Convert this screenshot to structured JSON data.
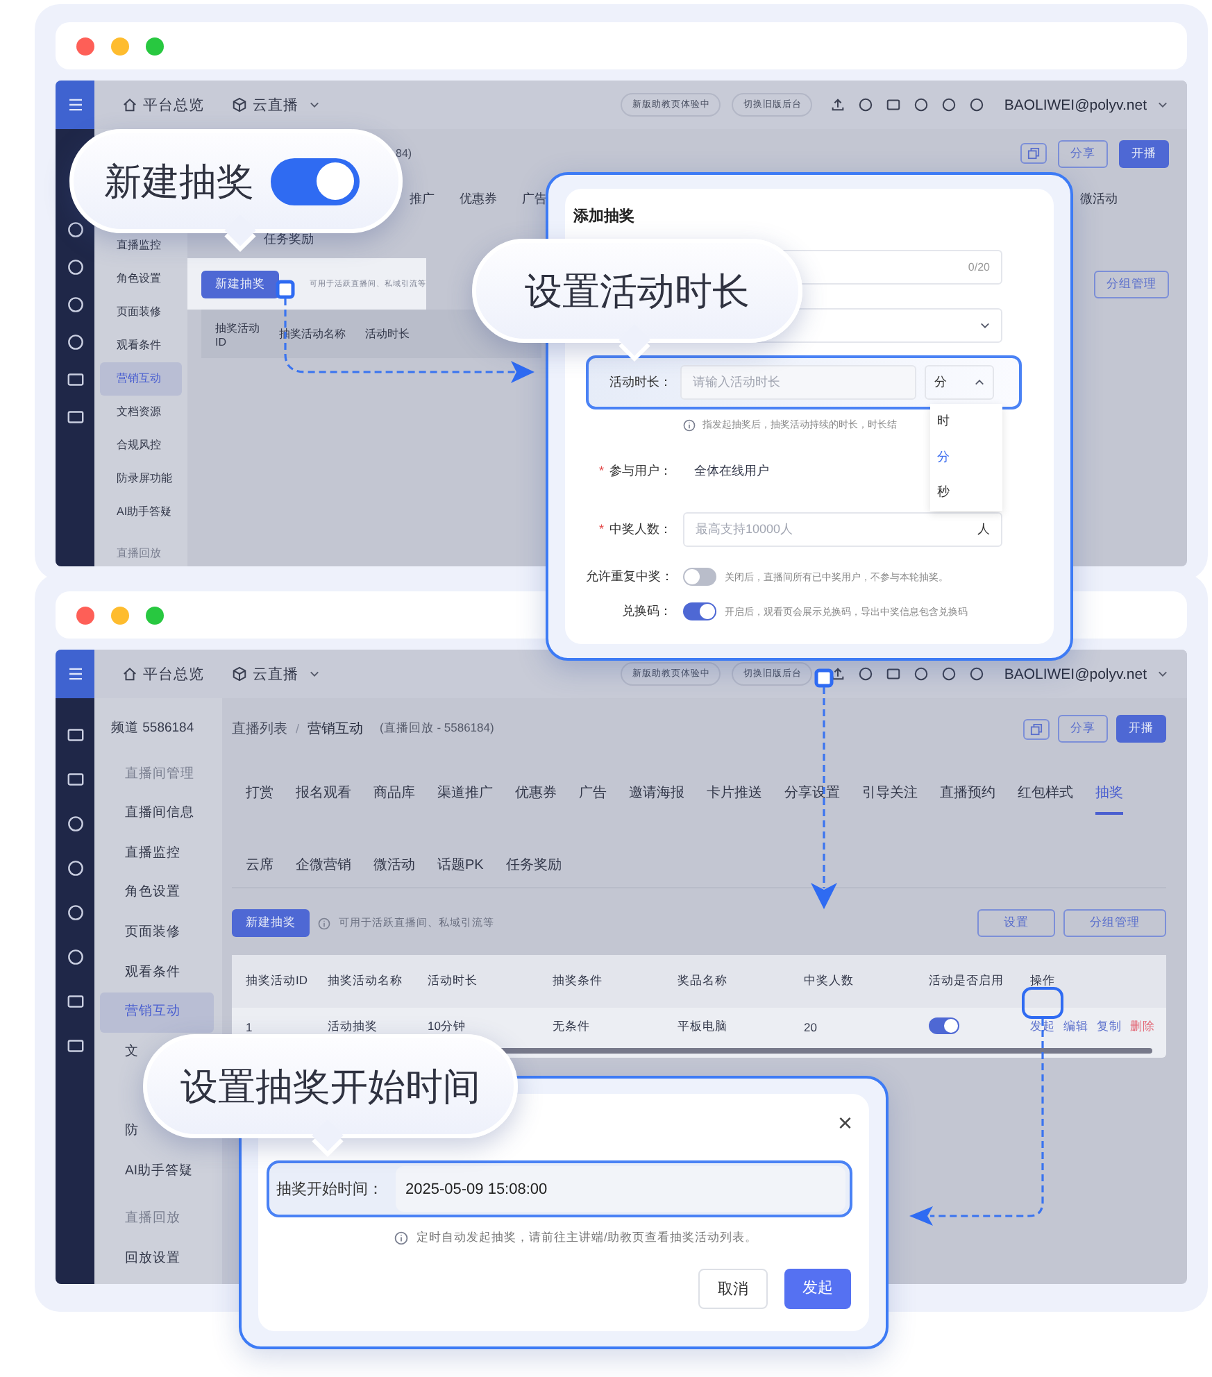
{
  "screen_1": {
    "topbar": {
      "home": "平台总览",
      "product": "云直播",
      "pills": [
        "新版助教页体验中",
        "切换旧版后台"
      ],
      "account": "BAOLIWEI@polyv.net"
    },
    "menu": [
      {
        "label": "直播监控",
        "kind": "item",
        "selected": false
      },
      {
        "label": "角色设置",
        "kind": "item",
        "selected": false
      },
      {
        "label": "页面装修",
        "kind": "item",
        "selected": false
      },
      {
        "label": "观看条件",
        "kind": "item",
        "selected": false
      },
      {
        "label": "营销互动",
        "kind": "item",
        "selected": true
      },
      {
        "label": "文档资源",
        "kind": "item",
        "selected": false
      },
      {
        "label": "合规风控",
        "kind": "item",
        "selected": false
      },
      {
        "label": "防录屏功能",
        "kind": "item",
        "selected": false
      },
      {
        "label": "AI助手答疑",
        "kind": "item",
        "selected": false
      },
      {
        "label": "直播回放",
        "kind": "section",
        "selected": false
      }
    ],
    "title_fragment": "84)",
    "actions": [
      {
        "label": "分享",
        "kind": "outline"
      },
      {
        "label": "开播",
        "kind": "primary"
      }
    ],
    "tabs": [
      {
        "label": "推广",
        "selected": false
      },
      {
        "label": "优惠券",
        "selected": false
      },
      {
        "label": "广告",
        "selected": false
      },
      {
        "label": "微活动",
        "selected": false
      }
    ],
    "tabs_row_2": [
      {
        "label": "任务奖励",
        "selected": false
      }
    ],
    "new_button": "新建抽奖",
    "hint": "可用于活跃直播间、私域引流等",
    "right_buttons": [
      "分组管理"
    ],
    "table_columns": [
      "抽奖活动ID",
      "抽奖活动名称",
      "活动时长"
    ]
  },
  "screen_2": {
    "topbar": {
      "home": "平台总览",
      "product": "云直播",
      "pills": [
        "新版助教页体验中",
        "切换旧版后台"
      ],
      "account": "BAOLIWEI@polyv.net"
    },
    "menu": [
      {
        "label": "频道 5586184",
        "kind": "back",
        "selected": false
      },
      {
        "label": "直播间管理",
        "kind": "section",
        "selected": false
      },
      {
        "label": "直播间信息",
        "kind": "item",
        "selected": false
      },
      {
        "label": "直播监控",
        "kind": "item",
        "selected": false
      },
      {
        "label": "角色设置",
        "kind": "item",
        "selected": false
      },
      {
        "label": "页面装修",
        "kind": "item",
        "selected": false
      },
      {
        "label": "观看条件",
        "kind": "item",
        "selected": false
      },
      {
        "label": "营销互动",
        "kind": "item",
        "selected": true
      },
      {
        "label": "文",
        "kind": "item",
        "selected": false
      },
      {
        "label": "防",
        "kind": "item",
        "selected": false
      },
      {
        "label": "AI助手答疑",
        "kind": "item",
        "selected": false
      },
      {
        "label": "直播回放",
        "kind": "section",
        "selected": false
      },
      {
        "label": "回放设置",
        "kind": "item",
        "selected": false
      }
    ],
    "breadcrumb": [
      "直播列表",
      "营销互动"
    ],
    "breadcrumb_separator": "/",
    "subtitle": "(直播回放 - 5586184)",
    "actions": [
      {
        "label": "分享",
        "kind": "outline"
      },
      {
        "label": "开播",
        "kind": "primary"
      }
    ],
    "tabs": [
      {
        "label": "打赏",
        "selected": false
      },
      {
        "label": "报名观看",
        "selected": false
      },
      {
        "label": "商品库",
        "selected": false
      },
      {
        "label": "渠道推广",
        "selected": false
      },
      {
        "label": "优惠券",
        "selected": false
      },
      {
        "label": "广告",
        "selected": false
      },
      {
        "label": "邀请海报",
        "selected": false
      },
      {
        "label": "卡片推送",
        "selected": false
      },
      {
        "label": "分享设置",
        "selected": false
      },
      {
        "label": "引导关注",
        "selected": false
      },
      {
        "label": "直播预约",
        "selected": false
      },
      {
        "label": "红包样式",
        "selected": false
      },
      {
        "label": "抽奖",
        "selected": true
      }
    ],
    "tabs_row_2": [
      {
        "label": "云席",
        "selected": false
      },
      {
        "label": "企微营销",
        "selected": false
      },
      {
        "label": "微活动",
        "selected": false
      },
      {
        "label": "话题PK",
        "selected": false
      },
      {
        "label": "任务奖励",
        "selected": false
      }
    ],
    "new_button": "新建抽奖",
    "hint": "可用于活跃直播间、私域引流等",
    "right_buttons": [
      "设置",
      "分组管理"
    ],
    "table": {
      "columns": [
        "抽奖活动ID",
        "抽奖活动名称",
        "活动时长",
        "抽奖条件",
        "奖品名称",
        "中奖人数",
        "活动是否启用",
        "操作"
      ],
      "rows": [
        {
          "cells": [
            "1",
            "活动抽奖",
            "10分钟",
            "无条件",
            "平板电脑",
            "20"
          ],
          "enabled": true,
          "operations": [
            {
              "label": "发起",
              "kind": "link"
            },
            {
              "label": "编辑",
              "kind": "link"
            },
            {
              "label": "复制",
              "kind": "link"
            },
            {
              "label": "删除",
              "kind": "danger"
            }
          ]
        }
      ]
    }
  },
  "dialog_1": {
    "title": "添加抽奖",
    "name_counter": "0/20",
    "duration": {
      "label": "活动时长：",
      "placeholder": "请输入活动时长",
      "unit": "分",
      "hint": "指发起抽奖后，抽奖活动持续的时长，时长结",
      "options": [
        {
          "label": "时",
          "selected": false
        },
        {
          "label": "分",
          "selected": true
        },
        {
          "label": "秒",
          "selected": false
        }
      ]
    },
    "fields": [
      {
        "label": "参与用户：",
        "value": "全体在线用户",
        "mark": "*"
      },
      {
        "label": "中奖人数：",
        "placeholder": "最高支持10000人",
        "suffix": "人",
        "mark": "*"
      }
    ],
    "switches": [
      {
        "label": "允许重复中奖：",
        "on": false,
        "note": "关闭后，直播间所有已中奖用户，不参与本轮抽奖。"
      },
      {
        "label": "兑换码：",
        "on": true,
        "note": "开启后，观看页会展示兑换码，导出中奖信息包含兑换码"
      }
    ]
  },
  "dialog_2": {
    "close": "×",
    "label": "抽奖开始时间：",
    "value": "2025-05-09 15:08:00",
    "hint": "定时自动发起抽奖，请前往主讲端/助教页查看抽奖活动列表。",
    "buttons": [
      {
        "label": "取消",
        "kind": "default"
      },
      {
        "label": "发起",
        "kind": "primary"
      }
    ]
  },
  "callouts": [
    {
      "text": "新建抽奖",
      "kind": "toggle",
      "on": true
    },
    {
      "text": "设置活动时长",
      "kind": "plain"
    },
    {
      "text": "设置抽奖开始时间",
      "kind": "plain"
    }
  ]
}
